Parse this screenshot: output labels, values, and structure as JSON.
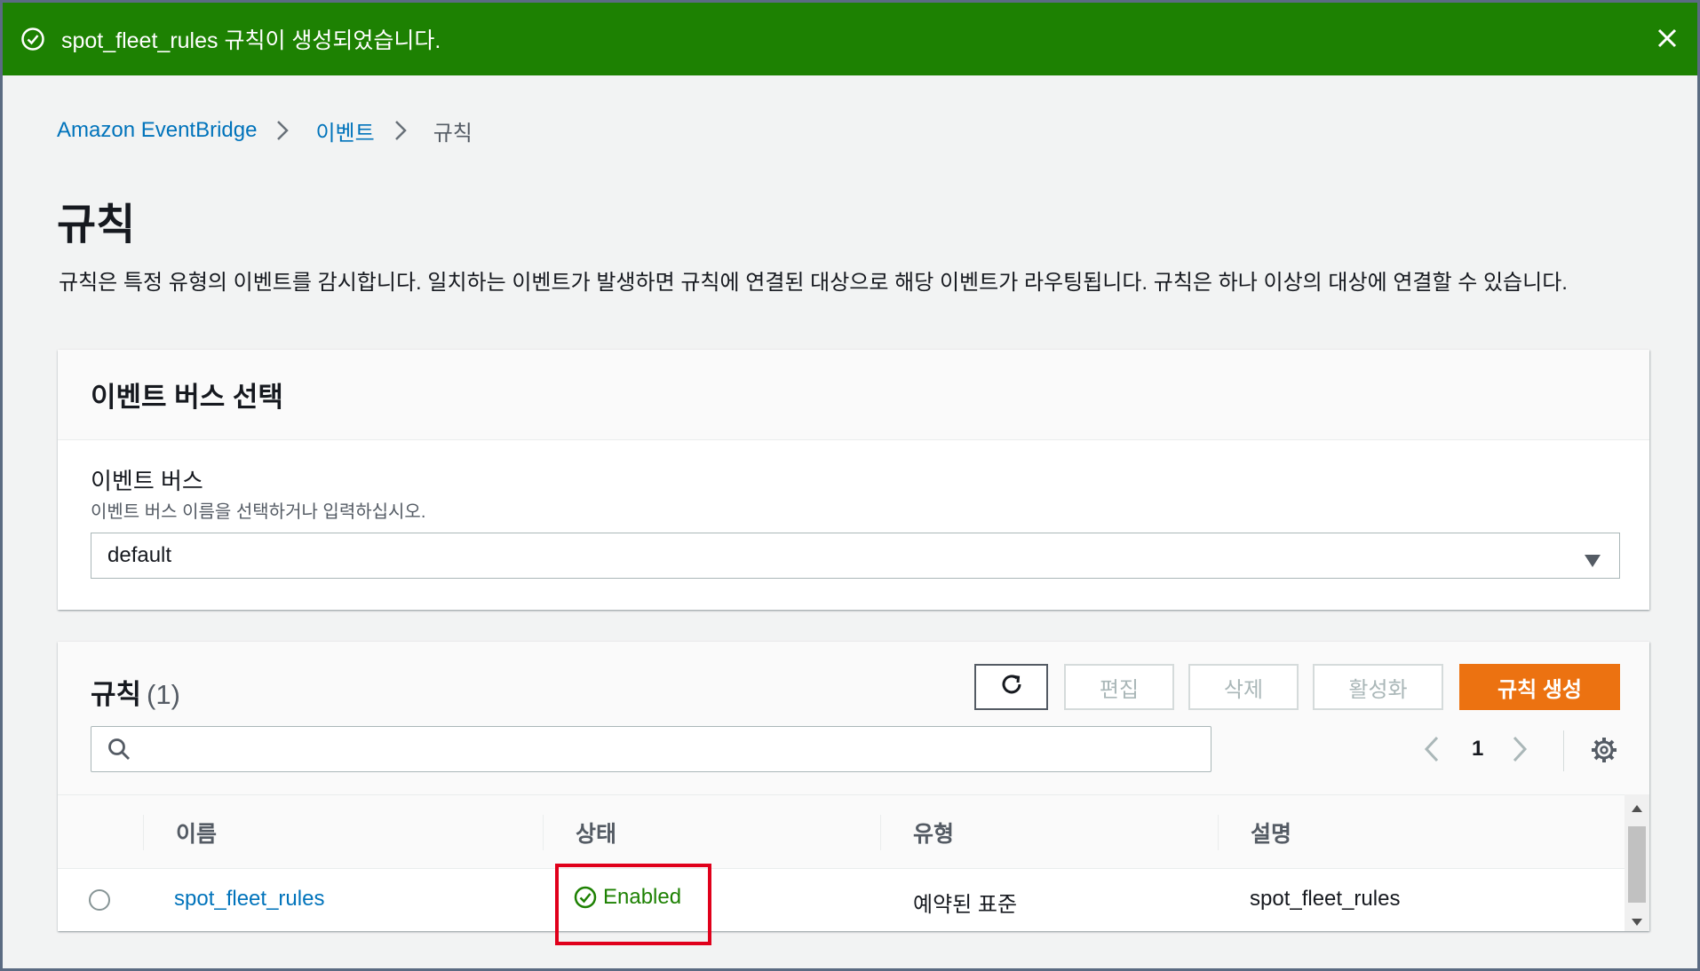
{
  "flash": {
    "message": "spot_fleet_rules 규칙이 생성되었습니다.",
    "type": "success",
    "color": "#1d8102"
  },
  "breadcrumb": {
    "items": [
      "Amazon EventBridge",
      "이벤트",
      "규칙"
    ]
  },
  "page": {
    "title": "규칙",
    "description": "규칙은 특정 유형의 이벤트를 감시합니다. 일치하는 이벤트가 발생하면 규칙에 연결된 대상으로 해당 이벤트가 라우팅됩니다. 규칙은 하나 이상의 대상에 연결할 수 있습니다."
  },
  "event_bus_panel": {
    "header": "이벤트 버스 선택",
    "field_label": "이벤트 버스",
    "field_hint": "이벤트 버스 이름을 선택하거나 입력하십시오.",
    "selected_value": "default"
  },
  "rules_panel": {
    "title": "규칙",
    "count": "(1)",
    "buttons": {
      "edit": "편집",
      "delete": "삭제",
      "enable": "활성화",
      "create": "규칙 생성"
    },
    "accent_color": "#ec7211",
    "search": {
      "placeholder": "",
      "value": ""
    },
    "pagination": {
      "current_page": "1"
    },
    "columns": [
      "이름",
      "상태",
      "유형",
      "설명"
    ],
    "rows": [
      {
        "name": "spot_fleet_rules",
        "status": "Enabled",
        "type": "예약된 표준",
        "description": "spot_fleet_rules"
      }
    ]
  },
  "icons": [
    "check-circle-icon",
    "close-icon",
    "chevron-right-icon",
    "caret-down-icon",
    "refresh-icon",
    "search-icon",
    "chevron-left-icon",
    "gear-icon"
  ]
}
